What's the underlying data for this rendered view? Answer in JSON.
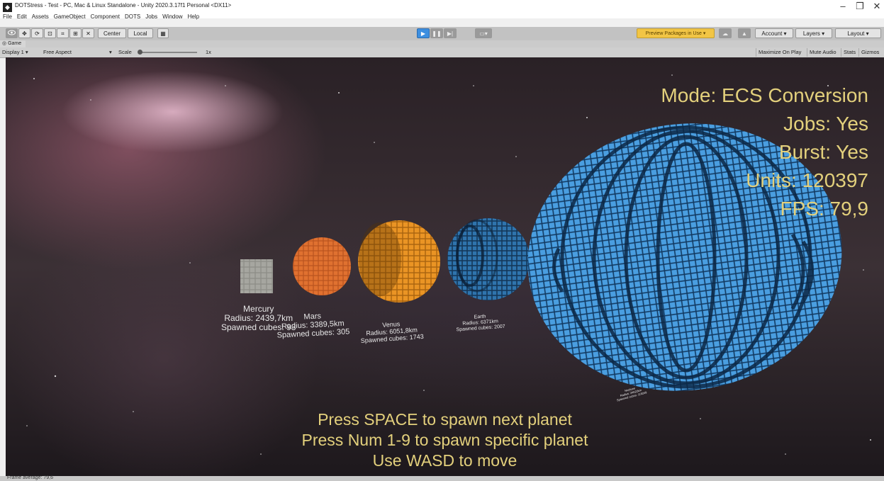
{
  "window": {
    "title": "DOTStress - Test - PC, Mac & Linux Standalone - Unity 2020.3.17f1 Personal <DX11>",
    "controls": [
      "–",
      "❐",
      "✕"
    ]
  },
  "menu": [
    "File",
    "Edit",
    "Assets",
    "GameObject",
    "Component",
    "DOTS",
    "Jobs",
    "Window",
    "Help"
  ],
  "toolbar": {
    "center_label": "Center",
    "local_label": "Local",
    "play_icon": "▶",
    "pause_icon": "❚❚",
    "step_icon": "▶|",
    "preview_label": "Preview Packages in Use ▾",
    "account_label": "Account ▾",
    "layers_label": "Layers ▾",
    "layout_label": "Layout ▾"
  },
  "tab": {
    "label": "Game"
  },
  "gamebar": {
    "display": "Display 1 ▾",
    "aspect": "Free Aspect",
    "aspect_arrow": "▾",
    "scale_label": "Scale",
    "scale_value": "1x",
    "maximize": "Maximize On Play",
    "mute": "Mute Audio",
    "stats": "Stats",
    "gizmos": "Gizmos"
  },
  "hud": {
    "mode": "Mode: ECS Conversion",
    "jobs": "Jobs: Yes",
    "burst": "Burst: Yes",
    "units": "Units: 120397",
    "fps": "FPS: 79,9"
  },
  "instructions": {
    "line1": "Press SPACE to spawn next planet",
    "line2": "Press Num 1-9 to spawn specific planet",
    "line3": "Use WASD to move"
  },
  "planets": [
    {
      "name": "Mercury",
      "radius": "Radius: 2439,7km",
      "cubes": "Spawned cubes: 93",
      "color": "#9a9a92"
    },
    {
      "name": "Mars",
      "radius": "Radius: 3389,5km",
      "cubes": "Spawned cubes: 305",
      "color": "#d8682a"
    },
    {
      "name": "Venus",
      "radius": "Radius: 6051,8km",
      "cubes": "Spawned cubes: 1743",
      "color": "#e08a1e"
    },
    {
      "name": "Earth",
      "radius": "Radius: 6371km",
      "cubes": "Spawned cubes: 2007",
      "color": "#2d6fa8"
    },
    {
      "name": "Neptune",
      "radius": "Radius: 24622km",
      "cubes": "Spawned cubes: 119249",
      "color": "#3d8ed0"
    }
  ],
  "status": "Frame average: 79,6"
}
